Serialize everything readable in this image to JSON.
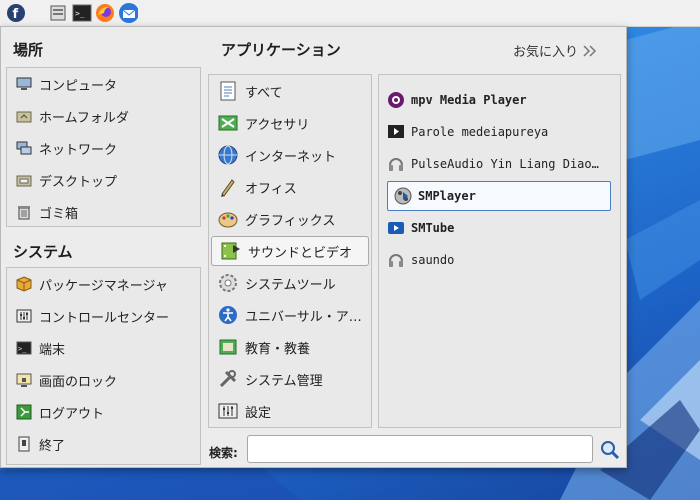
{
  "colors": {
    "accent": "#4a7fc4",
    "desktop": "#2d86e0",
    "panel": "#f0f0f0"
  },
  "panel": {
    "launchers": [
      {
        "name": "fedora-icon"
      },
      {
        "name": "file-manager-icon"
      },
      {
        "name": "terminal-icon"
      },
      {
        "name": "firefox-icon"
      },
      {
        "name": "thunderbird-icon"
      }
    ]
  },
  "places": {
    "heading": "場所",
    "items": [
      {
        "label": "コンピュータ",
        "icon": "computer-icon"
      },
      {
        "label": "ホームフォルダ",
        "icon": "home-folder-icon"
      },
      {
        "label": "ネットワーク",
        "icon": "network-icon"
      },
      {
        "label": "デスクトップ",
        "icon": "desktop-folder-icon"
      },
      {
        "label": "ゴミ箱",
        "icon": "trash-icon"
      }
    ]
  },
  "system": {
    "heading": "システム",
    "items": [
      {
        "label": "パッケージマネージャ",
        "icon": "package-icon"
      },
      {
        "label": "コントロールセンター",
        "icon": "control-center-icon"
      },
      {
        "label": "端末",
        "icon": "terminal-icon"
      },
      {
        "label": "画面のロック",
        "icon": "lock-screen-icon"
      },
      {
        "label": "ログアウト",
        "icon": "logout-icon"
      },
      {
        "label": "終了",
        "icon": "shutdown-icon"
      }
    ]
  },
  "applications": {
    "heading": "アプリケーション",
    "favorites_label": "お気に入り",
    "categories": [
      {
        "label": "すべて",
        "icon": "all-apps-icon"
      },
      {
        "label": "アクセサリ",
        "icon": "accessories-icon"
      },
      {
        "label": "インターネット",
        "icon": "internet-icon"
      },
      {
        "label": "オフィス",
        "icon": "office-icon"
      },
      {
        "label": "グラフィックス",
        "icon": "graphics-icon"
      },
      {
        "label": "サウンドとビデオ",
        "icon": "sound-video-icon",
        "selected": true
      },
      {
        "label": "システムツール",
        "icon": "system-tools-icon"
      },
      {
        "label": "ユニバーサル・ア…",
        "icon": "universal-access-icon"
      },
      {
        "label": "教育・教養",
        "icon": "education-icon"
      },
      {
        "label": "システム管理",
        "icon": "administration-icon"
      },
      {
        "label": "設定",
        "icon": "settings-icon"
      }
    ],
    "apps": [
      {
        "label": "mpv Media Player",
        "icon": "mpv-icon",
        "bold": true
      },
      {
        "label": "Parole medeiapureya",
        "icon": "parole-icon",
        "bold": false
      },
      {
        "label": "PulseAudio Yin Liang Diao…",
        "icon": "pulseaudio-icon",
        "bold": false
      },
      {
        "label": "SMPlayer",
        "icon": "smplayer-icon",
        "bold": true,
        "selected": true
      },
      {
        "label": "SMTube",
        "icon": "smtube-icon",
        "bold": true
      },
      {
        "label": "saundo",
        "icon": "sound-icon",
        "bold": false
      }
    ]
  },
  "search": {
    "label": "検索:",
    "value": "",
    "placeholder": ""
  }
}
